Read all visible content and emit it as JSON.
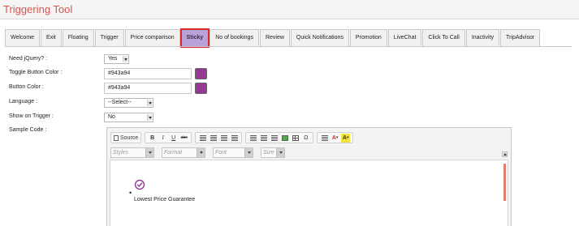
{
  "page": {
    "title": "Triggering Tool"
  },
  "tabs": [
    {
      "label": "Welcome"
    },
    {
      "label": "Exit"
    },
    {
      "label": "Floating"
    },
    {
      "label": "Trigger"
    },
    {
      "label": "Price comparison"
    },
    {
      "label": "Sticky",
      "active": true
    },
    {
      "label": "No of bookings"
    },
    {
      "label": "Review"
    },
    {
      "label": "Quick Notifications"
    },
    {
      "label": "Promotion"
    },
    {
      "label": "LiveChat"
    },
    {
      "label": "Click To Call"
    },
    {
      "label": "Inactivity"
    },
    {
      "label": "TripAdvisor"
    }
  ],
  "form": {
    "need_jquery": {
      "label": "Need jQuery? :",
      "value": "Yes"
    },
    "toggle_button_color": {
      "label": "Toggle Button Color :",
      "value": "#943a94",
      "swatch": "#943a94"
    },
    "button_color": {
      "label": "Button Color :",
      "value": "#943a94",
      "swatch": "#943a94"
    },
    "language": {
      "label": "Language :",
      "value": "--Select--"
    },
    "show_on_trigger": {
      "label": "Show on Trigger :",
      "value": "No"
    },
    "sample_code": {
      "label": "Sample Code :"
    }
  },
  "editor": {
    "toolbar": {
      "source_label": "Source",
      "bold": "B",
      "italic": "I",
      "underline": "U",
      "strike": "abc",
      "special_char": "Ω",
      "text_color": "A",
      "bg_color": "A"
    },
    "combos": {
      "styles": "Styles",
      "format": "Format",
      "font": "Font",
      "size": "Size"
    },
    "content": {
      "text": "Lowest Price Guarantee",
      "bullet": "•",
      "icon": "check-circle-icon",
      "icon_color": "#943a94"
    }
  },
  "colors": {
    "title": "#d9534f",
    "active_tab": "#b9a2d8",
    "highlight_border": "#d92626"
  }
}
